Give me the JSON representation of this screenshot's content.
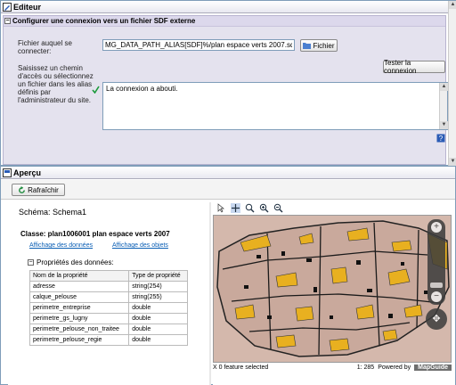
{
  "editor": {
    "title": "Editeur",
    "section_title": "Configurer une connexion vers un fichier SDF externe",
    "file_label": "Fichier auquel se connecter:",
    "file_value": "MG_DATA_PATH_ALIAS[SDF]%/plan espace verts 2007.sdf",
    "file_button": "Fichier",
    "help_text": "Saisissez un chemin d'accès ou sélectionnez un fichier dans les alias définis par l'administrateur du site.",
    "test_button": "Tester la connexion",
    "result_text": "La connexion a abouti."
  },
  "preview": {
    "title": "Aperçu",
    "refresh_button": "Rafraîchir",
    "schema": "Schéma: Schema1",
    "class": "Classe: plan1006001 plan espace verts 2007",
    "link_data": "Affichage des données",
    "link_objects": "Affichage des objets",
    "props_heading": "Propriétés des données:",
    "table": {
      "headers": [
        "Nom de la propriété",
        "Type de propriété"
      ],
      "rows": [
        [
          "adresse",
          "string(254)"
        ],
        [
          "calque_pelouse",
          "string(255)"
        ],
        [
          "perimetre_entreprise",
          "double"
        ],
        [
          "perimetre_gs_lugny",
          "double"
        ],
        [
          "perimetre_pelouse_non_traitee",
          "double"
        ],
        [
          "perimetre_pelouse_regie",
          "double"
        ]
      ]
    },
    "map_status_left": "X 0 feature selected",
    "map_scale": "1: 285",
    "powered_by": "Powered by",
    "mapguide": "MapGuide"
  },
  "colors": {
    "accent": "#0b5fb5",
    "map_bg": "#d4b8ac",
    "panel_bg": "#e4e2ee"
  },
  "icons": [
    "editor-icon",
    "preview-icon",
    "refresh-icon",
    "check-icon",
    "folder-icon",
    "help-icon",
    "zoom-in-icon",
    "zoom-out-icon",
    "pan-icon"
  ]
}
